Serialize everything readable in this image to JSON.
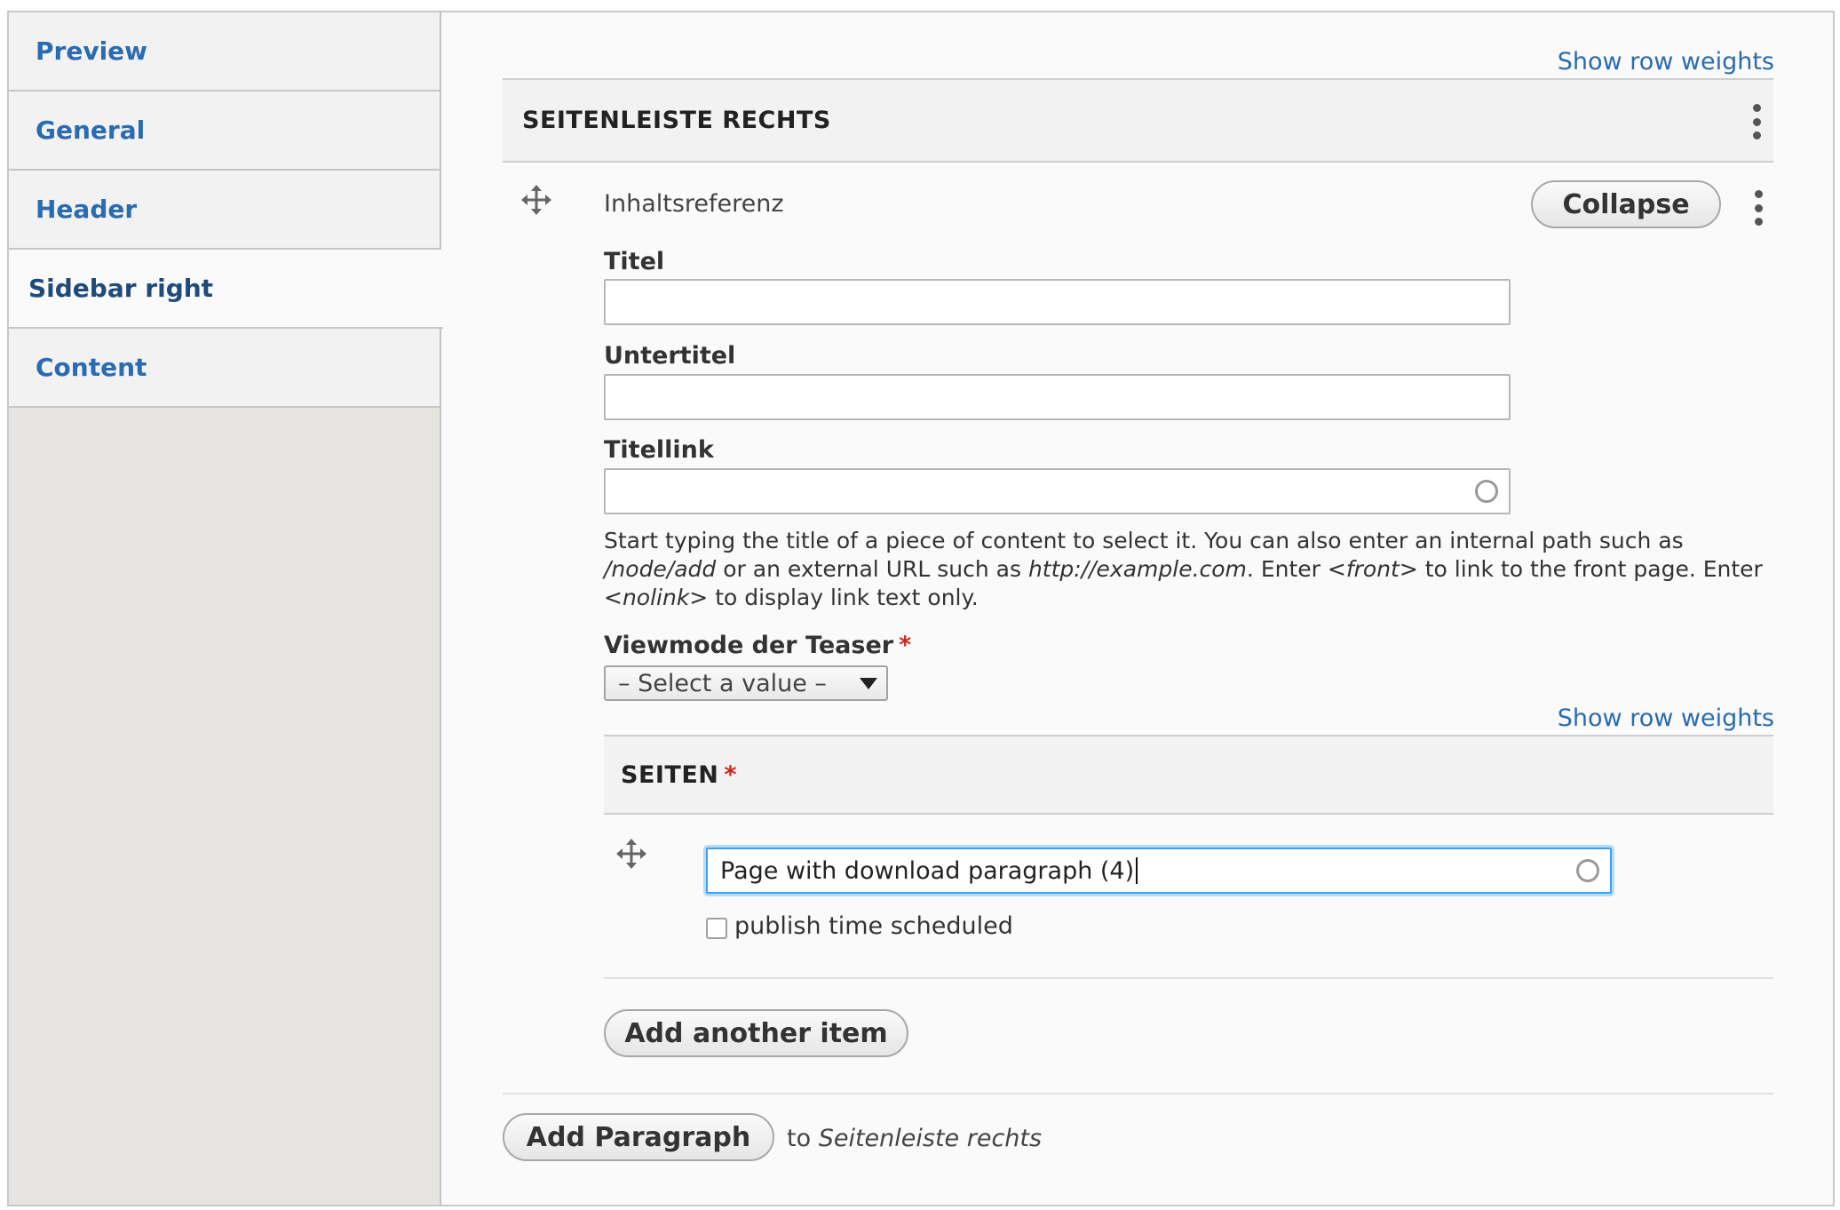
{
  "tabs": [
    {
      "label": "Preview"
    },
    {
      "label": "General"
    },
    {
      "label": "Header"
    },
    {
      "label": "Sidebar right"
    },
    {
      "label": "Content"
    }
  ],
  "outer": {
    "show_row_weights": "Show row weights",
    "section_title": "SEITENLEISTE RECHTS"
  },
  "paragraph": {
    "type_label": "Inhaltsreferenz",
    "collapse_label": "Collapse",
    "titel_label": "Titel",
    "titel_value": "",
    "untertitel_label": "Untertitel",
    "untertitel_value": "",
    "titellink_label": "Titellink",
    "titellink_value": "",
    "desc_1": "Start typing the title of a piece of content to select it. You can also enter an internal path such as ",
    "desc_node_add": "/node/add",
    "desc_2": " or an external URL such as ",
    "desc_url": "http://example.com",
    "desc_3": ". Enter ",
    "desc_front": "<front>",
    "desc_4": " to link to the front page. Enter ",
    "desc_nolink": "<nolink>",
    "desc_5": " to display link text only.",
    "viewmode_label": "Viewmode der Teaser",
    "required_mark": "*",
    "viewmode_value": "– Select a value –"
  },
  "seiten": {
    "show_row_weights": "Show row weights",
    "title": "SEITEN",
    "required_mark": "*",
    "entry_value": "Page with download paragraph (4)",
    "checkbox_label": "publish time scheduled",
    "add_another": "Add another item"
  },
  "footer": {
    "add_paragraph": "Add Paragraph",
    "to_text": "to",
    "target": "Seitenleiste rechts"
  },
  "icons": {
    "drag": "move-arrows-icon",
    "kebab": "kebab-menu-icon",
    "autocomplete": "autocomplete-throbber-icon",
    "dropdown": "triangle-down-icon"
  }
}
